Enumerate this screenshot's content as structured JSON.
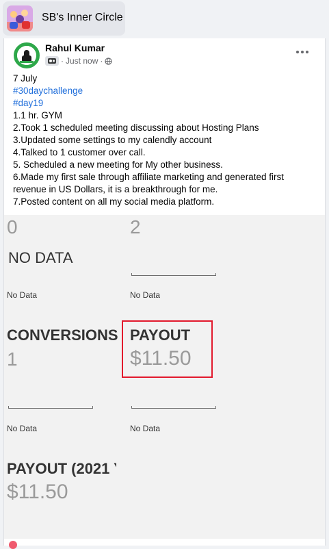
{
  "group": {
    "name": "SB's Inner Circle"
  },
  "post": {
    "author": "Rahul Kumar",
    "timestamp": "Just now",
    "separator": "·",
    "privacy_icon": "globe-icon",
    "lines": [
      "7 July",
      "#30daychallenge",
      "#day19",
      "1.1 hr. GYM",
      "2.Took 1 scheduled meeting discussing about Hosting Plans",
      "3.Updated some settings to my calendly account",
      "4.Talked to 1 customer over call.",
      "5. Scheduled a new meeting for My other business.",
      "6.Made my first sale through affiliate marketing and generated first",
      "revenue in US Dollars, it is a breakthrough for me.",
      "7.Posted content on all my social media platform."
    ]
  },
  "stats": {
    "top_left_value": "0",
    "top_right_value": "2",
    "no_data_heading": "NO DATA",
    "no_data_label": "No Data",
    "conversions_title": "CONVERSIONS",
    "conversions_value": "1",
    "payout_title": "PAYOUT",
    "payout_value": "$11.50",
    "payout_year_title": "PAYOUT (2021 Y",
    "payout_year_value": "$11.50"
  },
  "colors": {
    "highlight": "#e2192d",
    "hashtag": "#216fdb",
    "stat_value": "#9a9a9a"
  }
}
